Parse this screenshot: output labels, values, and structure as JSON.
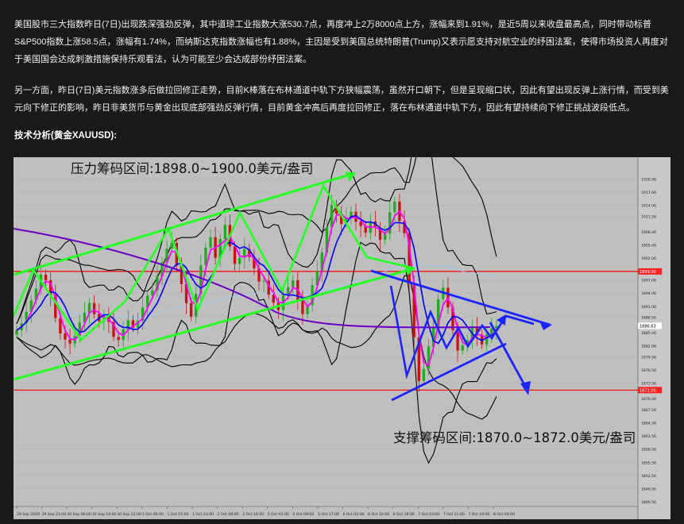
{
  "article": {
    "paragraph1": "美国股市三大指数昨日(7日)出现跌深强劲反弹，其中道琼工业指数大涨530.7点，再度冲上2万8000点上方，涨幅来到1.91%，是近5周以来收盘最高点，同时带动标普S&P500指数上涨58.5点，涨幅有1.74%，而纳斯达克指数涨幅也有1.88%，主因是受到美国总统特朗普(Trump)又表示愿支持对航空业的纾困法案，使得市场投资人再度对于美国国会达成刺激措施保持乐观看法，认为可能至少会达成部份纾困法案。",
    "paragraph2": "另一方面，昨日(7日)美元指数涨多后做拉回修正走势，目前K棒落在布林通道中轨下方狭幅震荡，虽然开口朝下，但是呈现缩口状，因此有望出现反弹上涨行情，而受到美元向下修正的影响，昨日非美货币与黄金出现底部强劲反弹行情，目前黄金冲高后再度拉回修正，落在布林通道中轨下方，因此有望持续向下修正挑战波段低点。",
    "section_heading": "技术分析(黄金XAUUSD):"
  },
  "chart_data": {
    "type": "candlestick",
    "instrument": "XAUUSD",
    "resistance_label": "压力筹码区间:1898.0~1900.0美元/盎司",
    "support_label": "支撑筹码区间:1870.0~1872.0美元/盎司",
    "resistance_level": 1899.0,
    "support_level": 1872.0,
    "current_price_tag": "1886.63",
    "upper_line_tag": "1899.00",
    "lower_line_tag": "1872.00",
    "ylim": [
      1845.5,
      1925.0
    ],
    "y_ticks": [
      "1920.06",
      "1917.06",
      "1914.06",
      "1911.56",
      "1908.06",
      "1905.06",
      "1902.06",
      "1899.06",
      "1897.06",
      "1894.06",
      "1891.06",
      "1888.56",
      "1885.06",
      "1882.06",
      "1879.56",
      "1876.56",
      "1873.56",
      "1870.06",
      "1867.56",
      "1864.56",
      "1861.56",
      "1858.56",
      "1855.56",
      "1852.56",
      "1849.56",
      "1846.56"
    ],
    "x_ticks": [
      "29 Sep 2020",
      "29 Sep 21:00",
      "30 Sep 06:00",
      "30 Sep 14:00",
      "30 Sep 22:00",
      "1 Oct 06:00",
      "1 Oct 15:00",
      "1 Oct 23:00",
      "2 Oct 08:00",
      "2 Oct 16:00",
      "5 Oct 01:00",
      "5 Oct 09:00",
      "5 Oct 17:00",
      "6 Oct 02:00",
      "6 Oct 10:00",
      "6 Oct 18:00",
      "7 Oct 03:00",
      "7 Oct 11:00",
      "7 Oct 19:00",
      "8 Oct 04:00"
    ],
    "colors": {
      "background": "#bfbfbf",
      "bull_candle": "#22aa22",
      "bear_candle": "#cc1111",
      "bollinger": "#000000",
      "ma_fast": "#ff00ff",
      "ma_mid": "#0000ff",
      "ma_slow": "#6a00c8",
      "channel": "#22ff22",
      "pattern": "#1a24ff",
      "level_line": "#ff0000"
    },
    "closes": [
      1885.6,
      1887.2,
      1889.8,
      1892.4,
      1895.1,
      1898.3,
      1897.0,
      1893.6,
      1888.4,
      1884.9,
      1883.5,
      1882.6,
      1884.3,
      1887.4,
      1889.6,
      1891.8,
      1889.3,
      1887.7,
      1889.0,
      1887.5,
      1884.1,
      1883.4,
      1885.8,
      1887.9,
      1886.2,
      1887.8,
      1890.8,
      1893.5,
      1894.7,
      1897.9,
      1901.1,
      1904.2,
      1905.5,
      1900.3,
      1896.1,
      1891.8,
      1888.7,
      1893.9,
      1900.4,
      1904.4,
      1906.8,
      1902.1,
      1906.4,
      1909.6,
      1904.7,
      1900.7,
      1902.1,
      1904.1,
      1902.3,
      1899.7,
      1896.7,
      1896.9,
      1893.7,
      1891.9,
      1890.2,
      1893.6,
      1895.4,
      1897.0,
      1892.3,
      1889.3,
      1891.3,
      1895.9,
      1899.1,
      1903.3,
      1909.1,
      1914.1,
      1912.1,
      1909.8,
      1911.2,
      1912.6,
      1910.3,
      1909.3,
      1907.8,
      1910.4,
      1909.0,
      1906.2,
      1907.6,
      1912.5,
      1914.9,
      1910.5,
      1907.7,
      1896.3,
      1884.0,
      1874.1,
      1876.8,
      1881.9,
      1886.3,
      1892.7,
      1895.3,
      1890.8,
      1885.6,
      1881.0,
      1882.2,
      1883.4,
      1886.2,
      1884.6,
      1882.4,
      1884.7,
      1886.0,
      1886.6
    ]
  }
}
